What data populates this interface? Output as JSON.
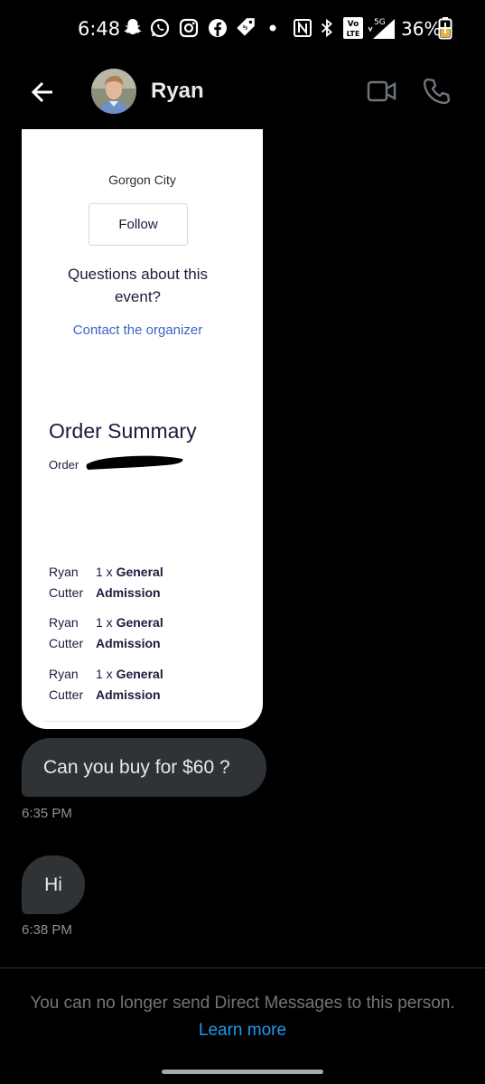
{
  "status_bar": {
    "time": "6:48",
    "battery": "36%",
    "icons": [
      "snapchat-icon",
      "whatsapp-icon",
      "instagram-icon",
      "facebook-icon",
      "tag-icon",
      "dot-icon",
      "nfc-icon",
      "bluetooth-icon",
      "volte-icon",
      "signal-5g-icon",
      "battery-charging-icon"
    ],
    "network_badge": "5G",
    "volte_badge_top": "Vo",
    "volte_badge_bottom": "LTE"
  },
  "header": {
    "contact_name": "Ryan",
    "back_icon": "arrow-left-icon",
    "video_icon": "video-camera-icon",
    "phone_icon": "phone-icon"
  },
  "shared_card": {
    "organizer_name": "Gorgon City",
    "follow_label": "Follow",
    "questions_text": "Questions about this event?",
    "contact_link": "Contact the organizer",
    "order_summary_title": "Order Summary",
    "order_label": "Order",
    "tickets": [
      {
        "name_line1": "Ryan",
        "name_line2": "Cutter",
        "qty": "1 x",
        "type_line1": "General",
        "type_line2": "Admission"
      },
      {
        "name_line1": "Ryan",
        "name_line2": "Cutter",
        "qty": "1 x",
        "type_line1": "General",
        "type_line2": "Admission"
      },
      {
        "name_line1": "Ryan",
        "name_line2": "Cutter",
        "qty": "1 x",
        "type_line1": "General",
        "type_line2": "Admission"
      }
    ]
  },
  "messages": [
    {
      "text": "Can you buy for $60 ?",
      "time": "6:35 PM"
    },
    {
      "text": "Hi",
      "time": "6:38 PM"
    }
  ],
  "footer": {
    "notice": "You can no longer send Direct Messages to this person.",
    "link": "Learn more"
  },
  "colors": {
    "background": "#000000",
    "bubble": "#2f3336",
    "link_blue": "#1d9bf0",
    "card_link": "#3d64c4",
    "muted_text": "#71767b"
  }
}
